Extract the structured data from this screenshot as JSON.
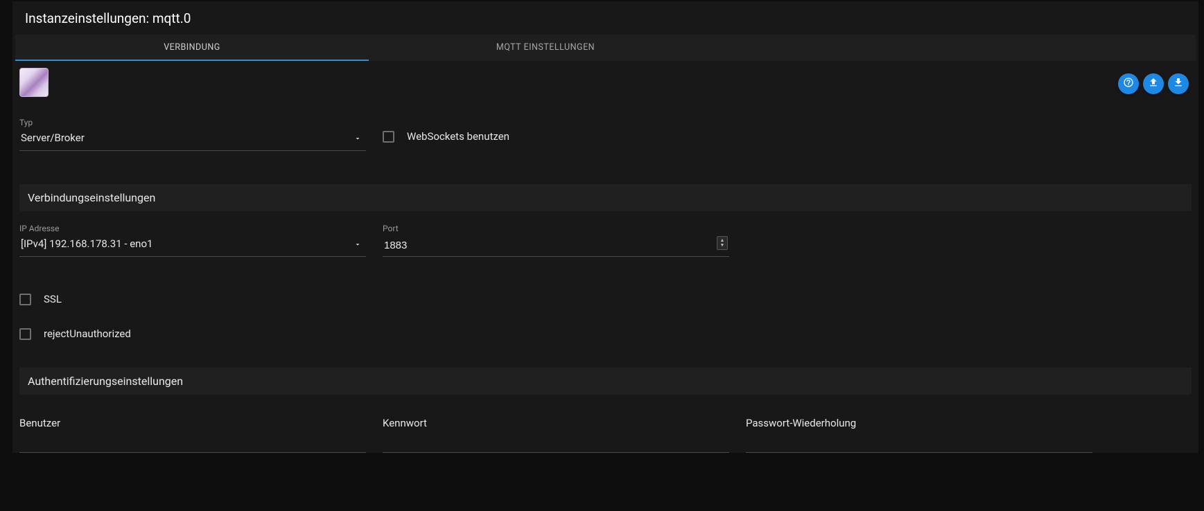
{
  "title": "Instanzeinstellungen: mqtt.0",
  "tabs": {
    "connection": "VERBINDUNG",
    "mqtt_settings": "MQTT EINSTELLUNGEN"
  },
  "fields": {
    "type_label": "Typ",
    "type_value": "Server/Broker",
    "websockets_label": "WebSockets benutzen",
    "conn_section": "Verbindungseinstellungen",
    "ip_label": "IP Adresse",
    "ip_value": "[IPv4] 192.168.178.31 - eno1",
    "port_label": "Port",
    "port_value": "1883",
    "ssl_label": "SSL",
    "reject_label": "rejectUnauthorized",
    "auth_section": "Authentifizierungseinstellungen",
    "user_label": "Benutzer",
    "pass_label": "Kennwort",
    "pass2_label": "Passwort-Wiederholung"
  },
  "icons": {
    "help": "help-icon",
    "upload": "upload-icon",
    "download": "download-icon"
  }
}
